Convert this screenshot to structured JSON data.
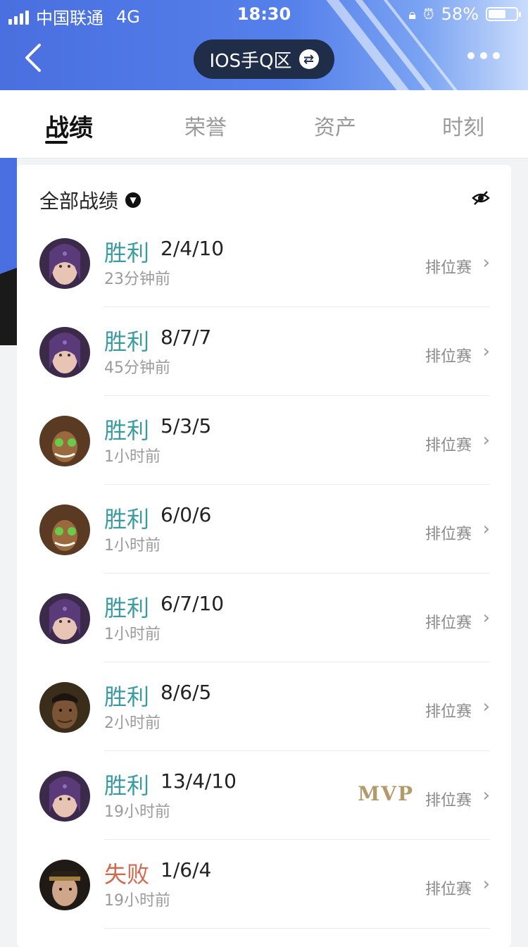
{
  "statusbar": {
    "carrier": "中国联通",
    "network": "4G",
    "time": "18:30",
    "battery": "58%"
  },
  "nav": {
    "server": "IOS手Q区",
    "swap_icon": "swap-icon",
    "more_icon": "more-icon"
  },
  "tabs": [
    {
      "label": "战绩",
      "active": true
    },
    {
      "label": "荣誉"
    },
    {
      "label": "资产"
    },
    {
      "label": "时刻"
    }
  ],
  "filter": {
    "label": "全部战绩"
  },
  "records": [
    {
      "result": "胜利",
      "kda": "2/4/10",
      "time": "23分钟前",
      "mode": "排位赛",
      "mvp": "",
      "avatar": "hero-a"
    },
    {
      "result": "胜利",
      "kda": "8/7/7",
      "time": "45分钟前",
      "mode": "排位赛",
      "mvp": "",
      "avatar": "hero-a"
    },
    {
      "result": "胜利",
      "kda": "5/3/5",
      "time": "1小时前",
      "mode": "排位赛",
      "mvp": "",
      "avatar": "hero-b"
    },
    {
      "result": "胜利",
      "kda": "6/0/6",
      "time": "1小时前",
      "mode": "排位赛",
      "mvp": "",
      "avatar": "hero-b"
    },
    {
      "result": "胜利",
      "kda": "6/7/10",
      "time": "1小时前",
      "mode": "排位赛",
      "mvp": "",
      "avatar": "hero-a"
    },
    {
      "result": "胜利",
      "kda": "8/6/5",
      "time": "2小时前",
      "mode": "排位赛",
      "mvp": "",
      "avatar": "hero-c"
    },
    {
      "result": "胜利",
      "kda": "13/4/10",
      "time": "19小时前",
      "mode": "排位赛",
      "mvp": "MVP",
      "avatar": "hero-a"
    },
    {
      "result": "失败",
      "kda": "1/6/4",
      "time": "19小时前",
      "mode": "排位赛",
      "mvp": "",
      "avatar": "hero-d"
    }
  ],
  "colors": {
    "win": "#3a9ca0",
    "lose": "#d2694f",
    "header": "#4a6fe0"
  }
}
